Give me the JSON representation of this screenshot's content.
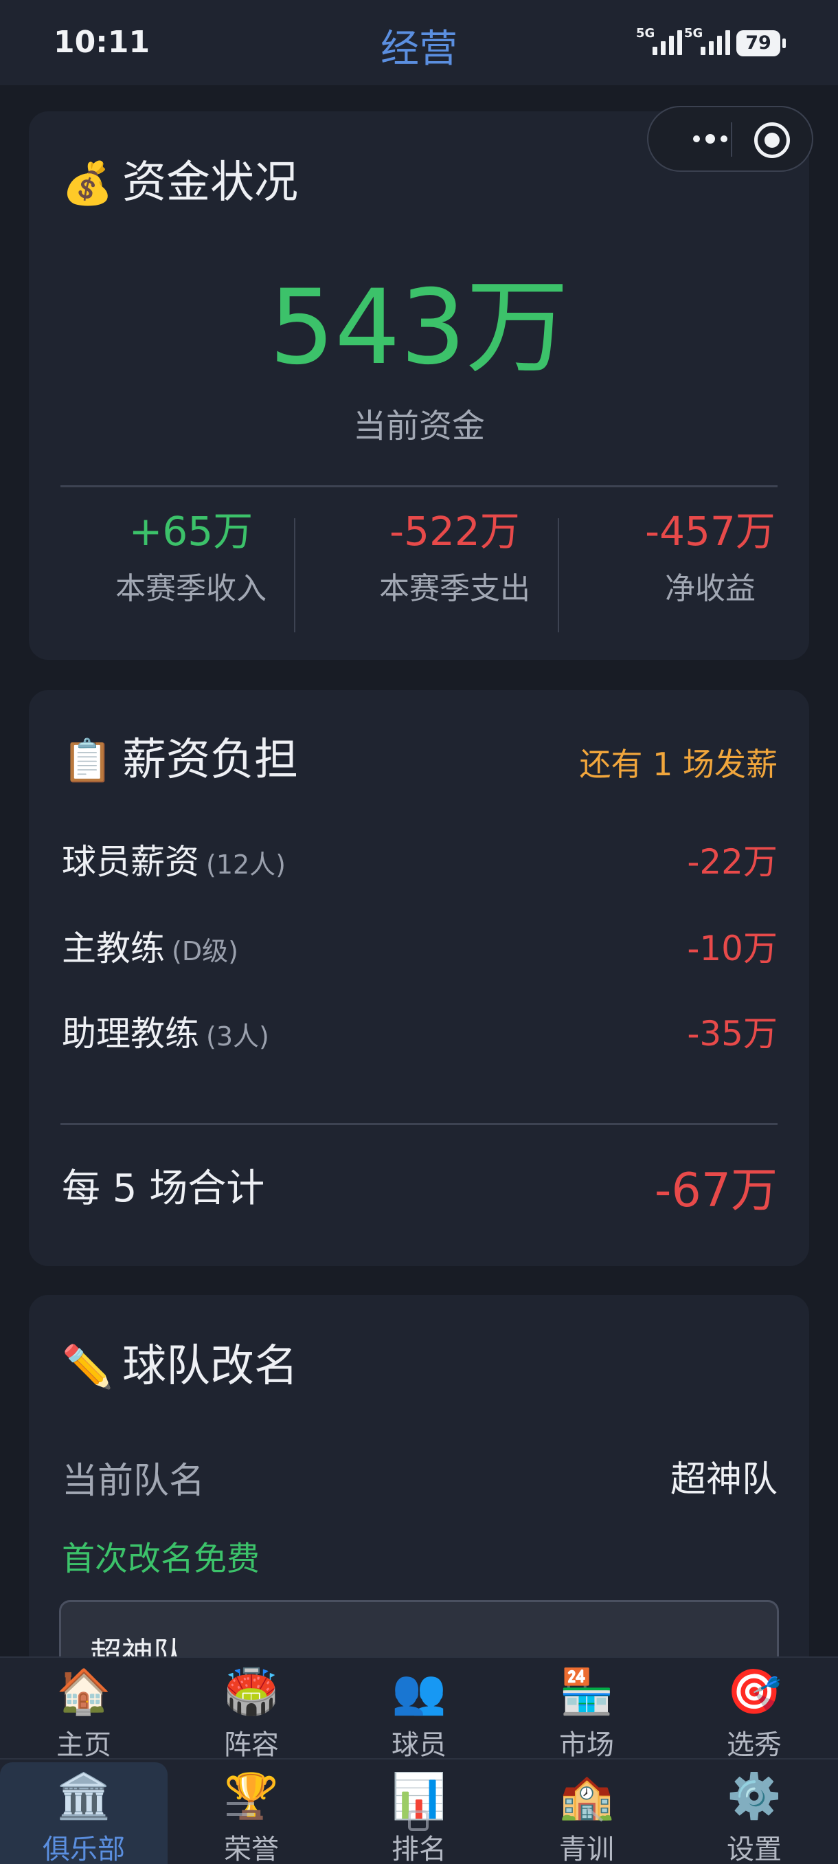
{
  "status_bar": {
    "time": "10:11",
    "network_1": "5G",
    "network_2": "5G",
    "battery": "79"
  },
  "header": {
    "title": "经营"
  },
  "funds": {
    "emoji": "💰",
    "title": "资金状况",
    "amount": "543万",
    "amount_label": "当前资金",
    "stats": [
      {
        "value": "+65万",
        "label": "本赛季收入"
      },
      {
        "value": "-522万",
        "label": "本赛季支出"
      },
      {
        "value": "-457万",
        "label": "净收益"
      }
    ]
  },
  "salary": {
    "emoji": "📋",
    "title": "薪资负担",
    "note": "还有 1 场发薪",
    "rows": [
      {
        "label": "球员薪资",
        "sub": "(12人)",
        "value": "-22万"
      },
      {
        "label": "主教练",
        "sub": "(D级)",
        "value": "-10万"
      },
      {
        "label": "助理教练",
        "sub": "(3人)",
        "value": "-35万"
      }
    ],
    "total_label": "每 5 场合计",
    "total_value": "-67万"
  },
  "rename": {
    "emoji": "✏️",
    "title": "球队改名",
    "current_label": "当前队名",
    "current_value": "超神队",
    "free_note": "首次改名免费",
    "input_value": "超神队"
  },
  "tabs_row1": [
    {
      "icon": "🏠",
      "label": "主页"
    },
    {
      "icon": "🏟️",
      "label": "阵容"
    },
    {
      "icon": "👥",
      "label": "球员"
    },
    {
      "icon": "🏪",
      "label": "市场"
    },
    {
      "icon": "🎯",
      "label": "选秀"
    }
  ],
  "tabs_row2": [
    {
      "icon": "🏛️",
      "label": "俱乐部"
    },
    {
      "icon": "🏆",
      "label": "荣誉"
    },
    {
      "icon": "📊",
      "label": "排名"
    },
    {
      "icon": "🏫",
      "label": "青训"
    },
    {
      "icon": "⚙️",
      "label": "设置"
    }
  ],
  "colors": {
    "background": "#181c25",
    "card": "#1f2430",
    "accent": "#5b8fe0",
    "positive": "#3cc26a",
    "negative": "#e84a4a",
    "warning": "#f1a63c"
  }
}
